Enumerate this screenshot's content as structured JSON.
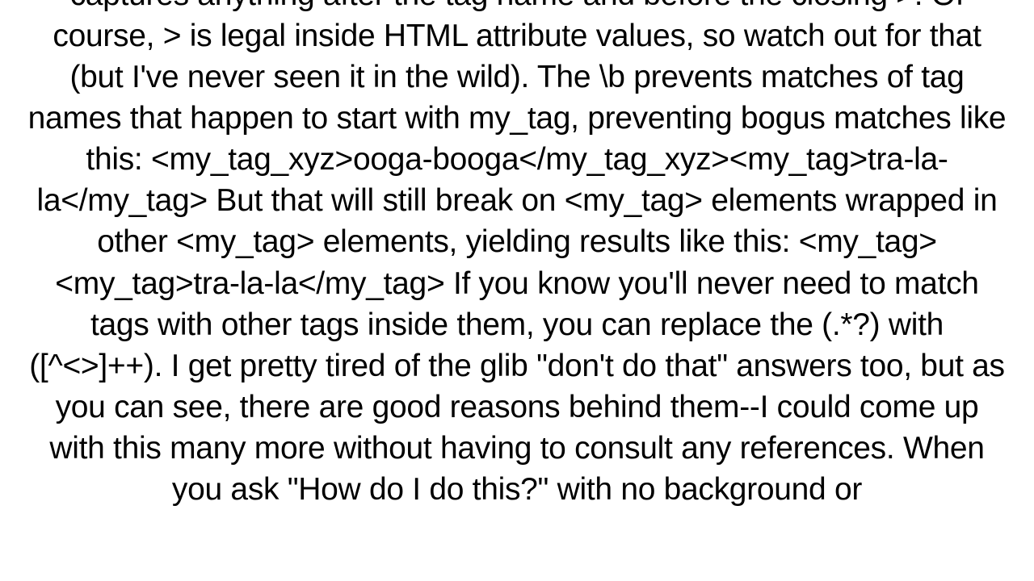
{
  "document": {
    "text": "captures anything after the tag name and before the closing >.  Of course, > is legal inside HTML attribute values, so watch out for that (but I've never seen it in the wild).  The \\b prevents matches of tag names that happen to start with my_tag, preventing bogus matches like this: <my_tag_xyz>ooga-booga</my_tag_xyz><my_tag>tra-la-la</my_tag>  But that will still break on <my_tag> elements wrapped in other <my_tag> elements, yielding results like this: <my_tag><my_tag>tra-la-la</my_tag>  If you know you'll never need to match tags with other tags inside them, you can replace the (.*?) with ([^<>]++). I get pretty tired of the glib \"don't do that\" answers too, but as you can see, there are good reasons behind them--I could come up with this many more without having to consult any references.  When you ask \"How do I do this?\" with no background or"
  }
}
